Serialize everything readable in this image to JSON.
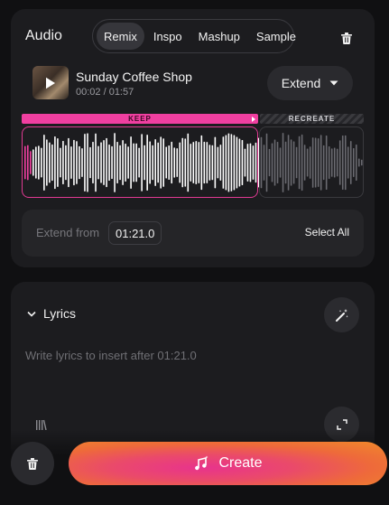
{
  "audio": {
    "title": "Audio",
    "tabs": [
      {
        "label": "Remix",
        "active": true
      },
      {
        "label": "Inspo",
        "active": false
      },
      {
        "label": "Mashup",
        "active": false
      },
      {
        "label": "Sample",
        "active": false
      }
    ],
    "track": {
      "name": "Sunday Coffee Shop",
      "time": "00:02 / 01:57"
    },
    "extend_label": "Extend",
    "keep_label": "KEEP",
    "recreate_label": "RECREATE",
    "extend_from": {
      "label": "Extend from",
      "value": "01:21.0"
    },
    "select_all": "Select All"
  },
  "lyrics": {
    "title": "Lyrics",
    "placeholder": "Write lyrics to insert after 01:21.0"
  },
  "create_button": "Create",
  "colors": {
    "accent_pink": "#f03fa0",
    "accent_orange": "#f08a2a",
    "background": "#101012",
    "card": "#1c1c1f"
  },
  "icons": {
    "delete": "trash-icon",
    "play": "play-icon",
    "dropdown": "chevron-down-icon",
    "expand": "chevron-down-icon",
    "magic": "magic-wand-icon",
    "create": "music-note-sparkle-icon"
  }
}
